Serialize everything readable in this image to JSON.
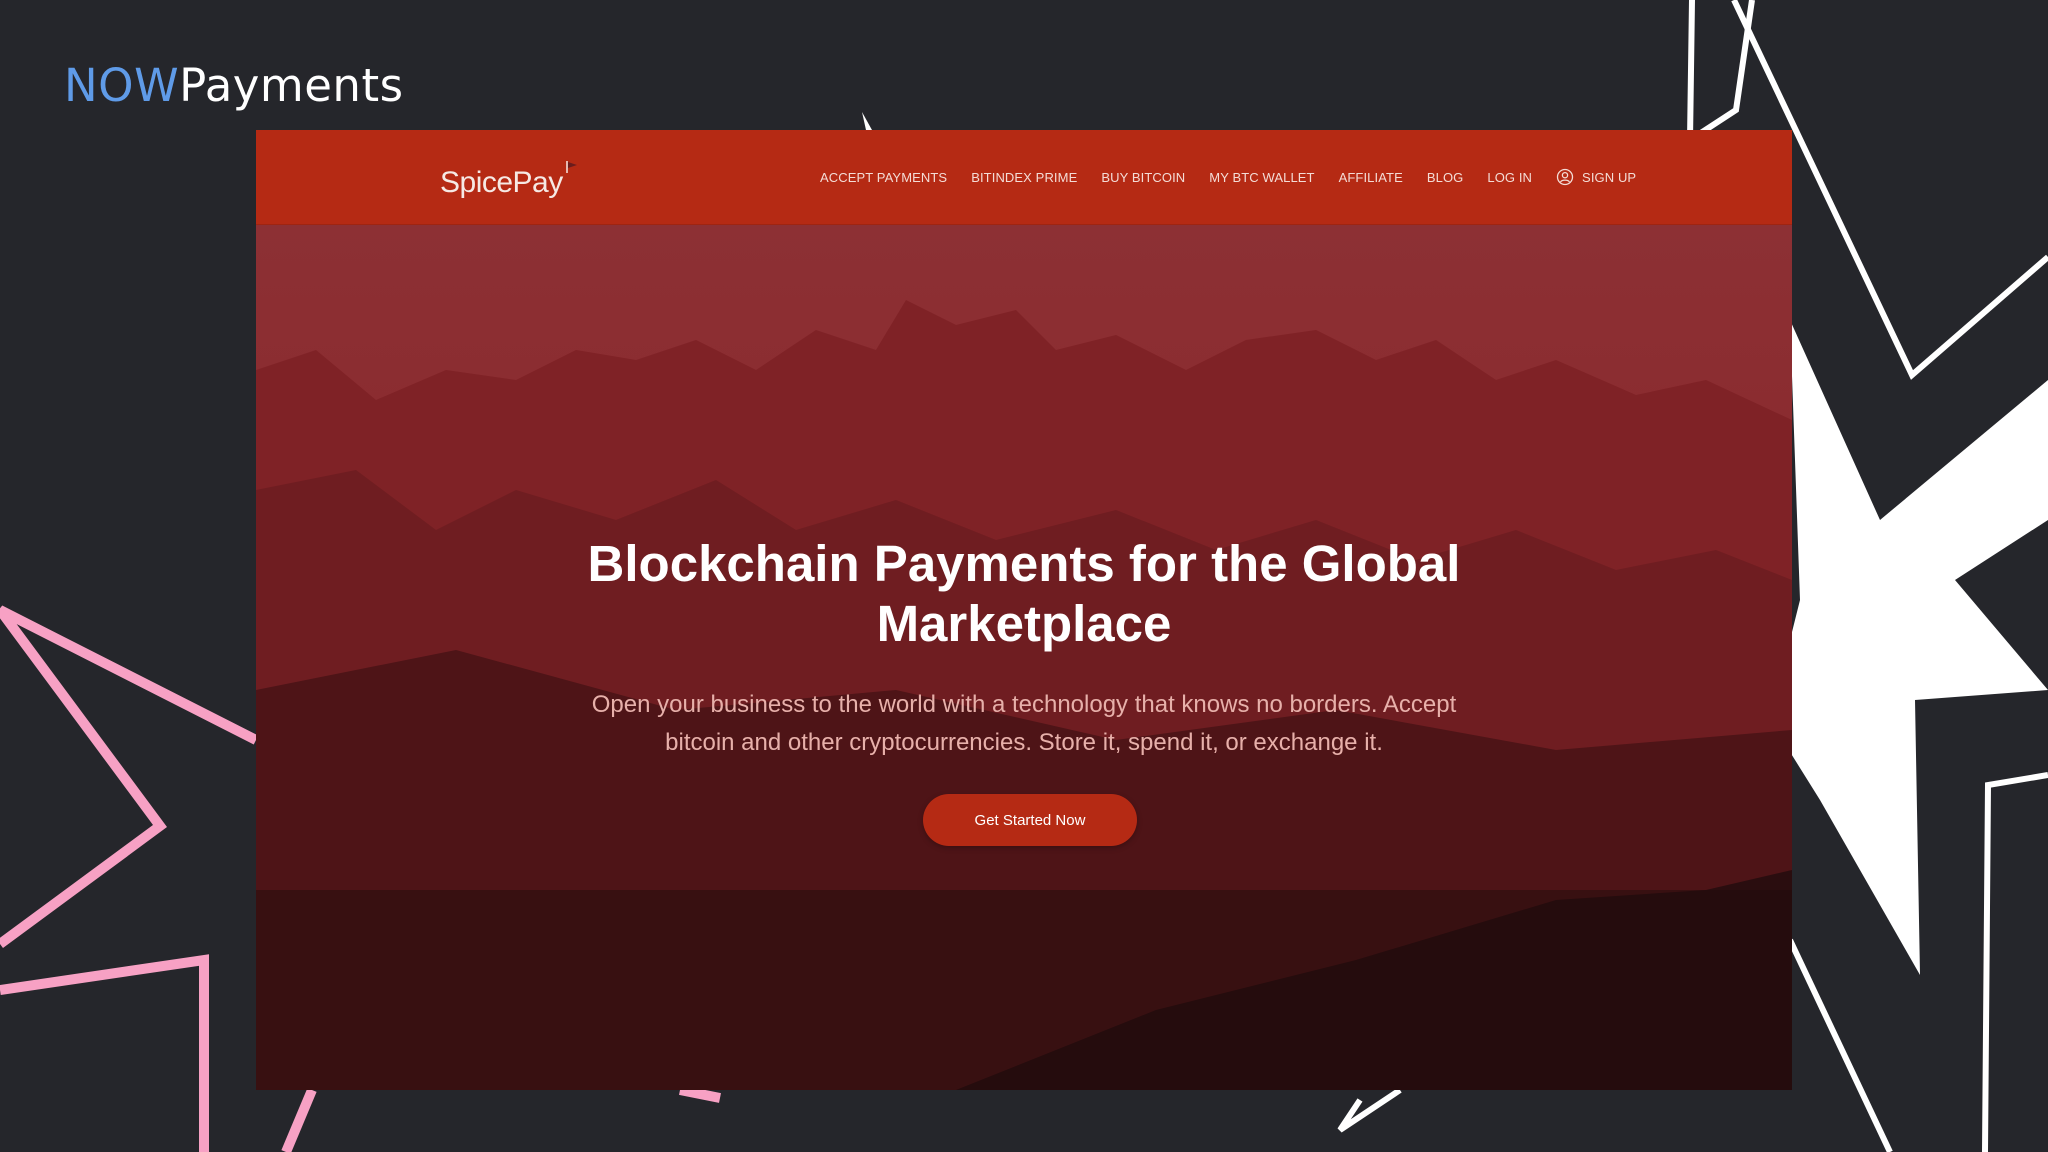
{
  "brand": {
    "part1": "NOW",
    "part2": "Payments"
  },
  "site": {
    "logo": "SpicePay",
    "nav": [
      {
        "label": "ACCEPT PAYMENTS"
      },
      {
        "label": "BITINDEX PRIME"
      },
      {
        "label": "BUY BITCOIN"
      },
      {
        "label": "MY BTC WALLET"
      },
      {
        "label": "AFFILIATE"
      },
      {
        "label": "BLOG"
      },
      {
        "label": "LOG IN"
      }
    ],
    "signup": {
      "label": "SIGN UP",
      "icon": "user-circle-icon"
    },
    "hero": {
      "headline": "Blockchain Payments for the Global Marketplace",
      "subtext": "Open your business to the world with a technology that knows no borders. Accept bitcoin and other cryptocurrencies. Store it, spend it, or exchange it.",
      "cta": "Get Started Now"
    }
  },
  "colors": {
    "background": "#25262b",
    "accent_blue": "#5f9be8",
    "nav_red": "#b52a14",
    "pink_star": "#f7a1c4",
    "white_star": "#ffffff"
  }
}
